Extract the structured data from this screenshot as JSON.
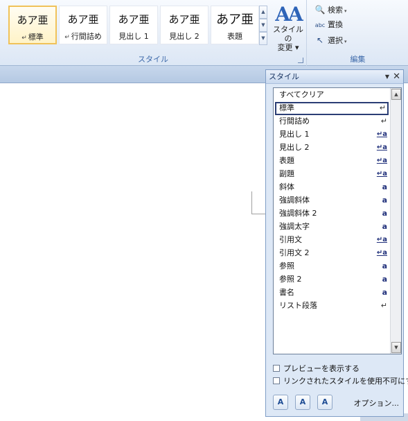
{
  "ribbon": {
    "gallery": [
      {
        "sample": "あア亜",
        "mark": "↵",
        "name": "標準",
        "selected": true
      },
      {
        "sample": "あア亜",
        "mark": "↵",
        "name": "行間詰め",
        "selected": false
      },
      {
        "sample": "あア亜",
        "mark": "",
        "name": "見出し 1",
        "selected": false
      },
      {
        "sample": "あア亜",
        "mark": "",
        "name": "見出し 2",
        "selected": false
      },
      {
        "sample": "あア亜",
        "mark": "",
        "name": "表題",
        "selected": false
      }
    ],
    "gallery_scroll": {
      "up": "▲",
      "down": "▼",
      "more": "▼"
    },
    "change_styles": {
      "icon": "AA",
      "label_line1": "スタイルの",
      "label_line2": "変更",
      "dropdown": "▾"
    },
    "styles_group_label": "スタイル",
    "edit": {
      "find": {
        "icon": "🔍",
        "label": "検索",
        "dropdown": "▾"
      },
      "replace": {
        "icon": "abc",
        "label": "置換"
      },
      "select": {
        "icon": "↖",
        "label": "選択",
        "dropdown": "▾"
      },
      "group_label": "編集"
    }
  },
  "pane": {
    "title": "スタイル",
    "menu_arrow": "▼",
    "close": "✕",
    "styles": [
      {
        "name": "すべてクリア",
        "indicator": "",
        "kind": "none",
        "selected": false
      },
      {
        "name": "標準",
        "indicator": "↵",
        "kind": "para",
        "selected": true
      },
      {
        "name": "行間詰め",
        "indicator": "↵",
        "kind": "para",
        "selected": false
      },
      {
        "name": "見出し 1",
        "indicator": "↵a",
        "kind": "linked",
        "selected": false
      },
      {
        "name": "見出し 2",
        "indicator": "↵a",
        "kind": "linked",
        "selected": false
      },
      {
        "name": "表題",
        "indicator": "↵a",
        "kind": "linked",
        "selected": false
      },
      {
        "name": "副題",
        "indicator": "↵a",
        "kind": "linked",
        "selected": false
      },
      {
        "name": "斜体",
        "indicator": "a",
        "kind": "char",
        "selected": false
      },
      {
        "name": "強調斜体",
        "indicator": "a",
        "kind": "char",
        "selected": false
      },
      {
        "name": "強調斜体 2",
        "indicator": "a",
        "kind": "char",
        "selected": false
      },
      {
        "name": "強調太字",
        "indicator": "a",
        "kind": "char",
        "selected": false
      },
      {
        "name": "引用文",
        "indicator": "↵a",
        "kind": "linked",
        "selected": false
      },
      {
        "name": "引用文 2",
        "indicator": "↵a",
        "kind": "linked",
        "selected": false
      },
      {
        "name": "参照",
        "indicator": "a",
        "kind": "char",
        "selected": false
      },
      {
        "name": "参照 2",
        "indicator": "a",
        "kind": "char",
        "selected": false
      },
      {
        "name": "書名",
        "indicator": "a",
        "kind": "char",
        "selected": false
      },
      {
        "name": "リスト段落",
        "indicator": "↵",
        "kind": "para",
        "selected": false
      }
    ],
    "scroll": {
      "up": "▲",
      "down": "▼"
    },
    "preview_checkbox": {
      "label": "プレビューを表示する",
      "checked": false
    },
    "linked_checkbox": {
      "label": "リンクされたスタイルを使用不可にする",
      "checked": false
    },
    "buttons": {
      "new_style": "A",
      "style_inspector": "A",
      "manage_styles": "A"
    },
    "options": "オプション..."
  }
}
